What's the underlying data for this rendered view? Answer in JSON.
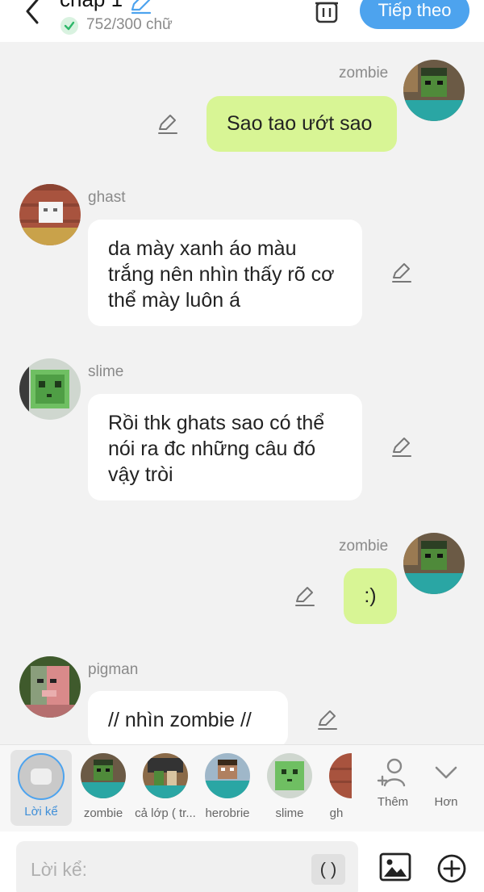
{
  "header": {
    "title": "chap 1",
    "word_count": "752/300 chữ",
    "next_label": "Tiếp theo"
  },
  "messages": [
    {
      "sender": "zombie",
      "text": "Sao tao ướt sao",
      "side": "right"
    },
    {
      "sender": "ghast",
      "text": "da mày xanh áo màu trắng nên nhìn thấy rõ cơ thể mày luôn á",
      "side": "left"
    },
    {
      "sender": "slime",
      "text": "Rồi thk ghats sao có thể nói ra đc những câu đó vậy tròi",
      "side": "left"
    },
    {
      "sender": "zombie",
      "text": ":)",
      "side": "right"
    },
    {
      "sender": "pigman",
      "text": "// nhìn zombie //",
      "side": "left"
    }
  ],
  "characters": [
    {
      "label": "Lời kể",
      "selected": true
    },
    {
      "label": "zombie"
    },
    {
      "label": "cả lớp ( tr..."
    },
    {
      "label": "herobrie"
    },
    {
      "label": "slime"
    },
    {
      "label": "gh"
    }
  ],
  "actions": {
    "add_label": "Thêm",
    "more_label": "Hơn"
  },
  "input": {
    "placeholder": "Lời kể:",
    "paren_label": "( )"
  },
  "colors": {
    "accent": "#4da3ee",
    "right_bubble": "#d8f595",
    "left_bubble": "#ffffff",
    "background": "#f2f2f2"
  }
}
